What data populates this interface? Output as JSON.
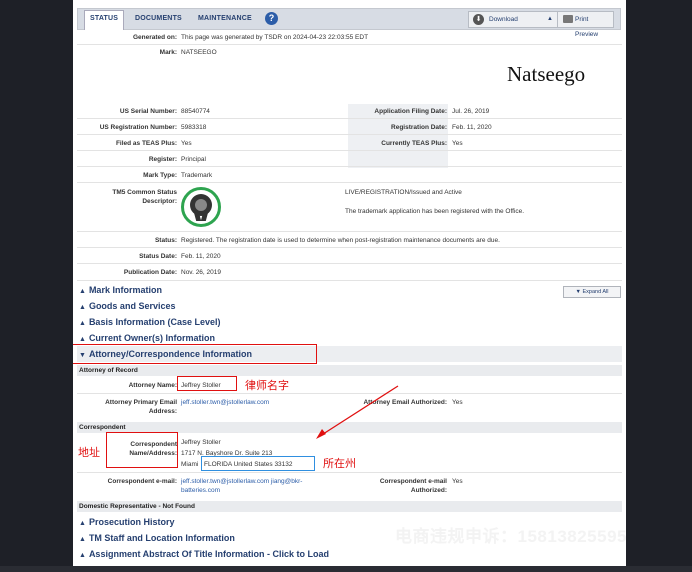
{
  "tabs": [
    {
      "label": "STATUS",
      "active": true
    },
    {
      "label": "DOCUMENTS",
      "active": false
    },
    {
      "label": "MAINTENANCE",
      "active": false
    }
  ],
  "help_icon": "?",
  "toolbar": {
    "download_label": "Download",
    "print_label": "Print Preview"
  },
  "generated": {
    "label": "Generated on:",
    "value": "This page was generated by TSDR on 2024-04-23 22:03:55 EDT"
  },
  "mark": {
    "label": "Mark:",
    "value": "NATSEEGO",
    "display": "Natseego"
  },
  "fields": {
    "serial": {
      "label": "US Serial Number:",
      "value": "88540774"
    },
    "filing": {
      "label": "Application Filing Date:",
      "value": "Jul. 26, 2019"
    },
    "regnum": {
      "label": "US Registration Number:",
      "value": "5983318"
    },
    "regdate": {
      "label": "Registration Date:",
      "value": "Feb. 11, 2020"
    },
    "teas": {
      "label": "Filed as TEAS Plus:",
      "value": "Yes"
    },
    "curteas": {
      "label": "Currently TEAS Plus:",
      "value": "Yes"
    },
    "register": {
      "label": "Register:",
      "value": "Principal"
    },
    "marktype": {
      "label": "Mark Type:",
      "value": "Trademark"
    },
    "tm5": {
      "label1": "TM5 Common Status",
      "label2": "Descriptor:",
      "value1": "LIVE/REGISTRATION/Issued and Active",
      "value2": "The trademark application has been registered with the Office."
    },
    "status": {
      "label": "Status:",
      "value": "Registered. The registration date is used to determine when post-registration maintenance documents are due."
    },
    "statusdate": {
      "label": "Status Date:",
      "value": "Feb. 11, 2020"
    },
    "pubdate": {
      "label": "Publication Date:",
      "value": "Nov. 26, 2019"
    }
  },
  "sections": {
    "mark_info": "Mark Information",
    "goods": "Goods and Services",
    "basis": "Basis Information (Case Level)",
    "owner": "Current Owner(s) Information",
    "attorney": "Attorney/Correspondence Information",
    "prosecution": "Prosecution History",
    "staff": "TM Staff and Location Information",
    "assignment": "Assignment Abstract Of Title Information - Click to Load"
  },
  "expand_all": "Expand All",
  "attorney": {
    "heading": "Attorney of Record",
    "name_label": "Attorney Name:",
    "name_value": "Jeffrey Stoller",
    "email_label1": "Attorney Primary Email",
    "email_label2": "Address:",
    "email_value": "jeff.stoller.twn@jstollerlaw.com",
    "auth_label": "Attorney Email Authorized:",
    "auth_value": "Yes"
  },
  "correspondent": {
    "heading": "Correspondent",
    "label1": "Correspondent",
    "label2": "Name/Address:",
    "line1": "Jeffrey Stoller",
    "line2": "1717 N. Bayshore Dr. Suite 213",
    "city": "Miami",
    "state": "FLORIDA United States 33132",
    "email_label": "Correspondent e-mail:",
    "email_line1": "jeff.stoller.twn@jstollerlaw.com jiang@bkr-",
    "email_line2": "batteries.com",
    "email_auth_label1": "Correspondent e-mail",
    "email_auth_label2": "Authorized:",
    "email_auth_value": "Yes"
  },
  "domestic": "Domestic Representative - Not Found",
  "annotations": {
    "lawyer_name": "律师名字",
    "address": "地址",
    "state": "所在州"
  },
  "watermark": "电商违规申诉：15813825595",
  "colors": {
    "accent": "#264070",
    "annotation_red": "#e01010",
    "annotation_blue": "#2f8fe0",
    "seal_green": "#2ea44f"
  }
}
